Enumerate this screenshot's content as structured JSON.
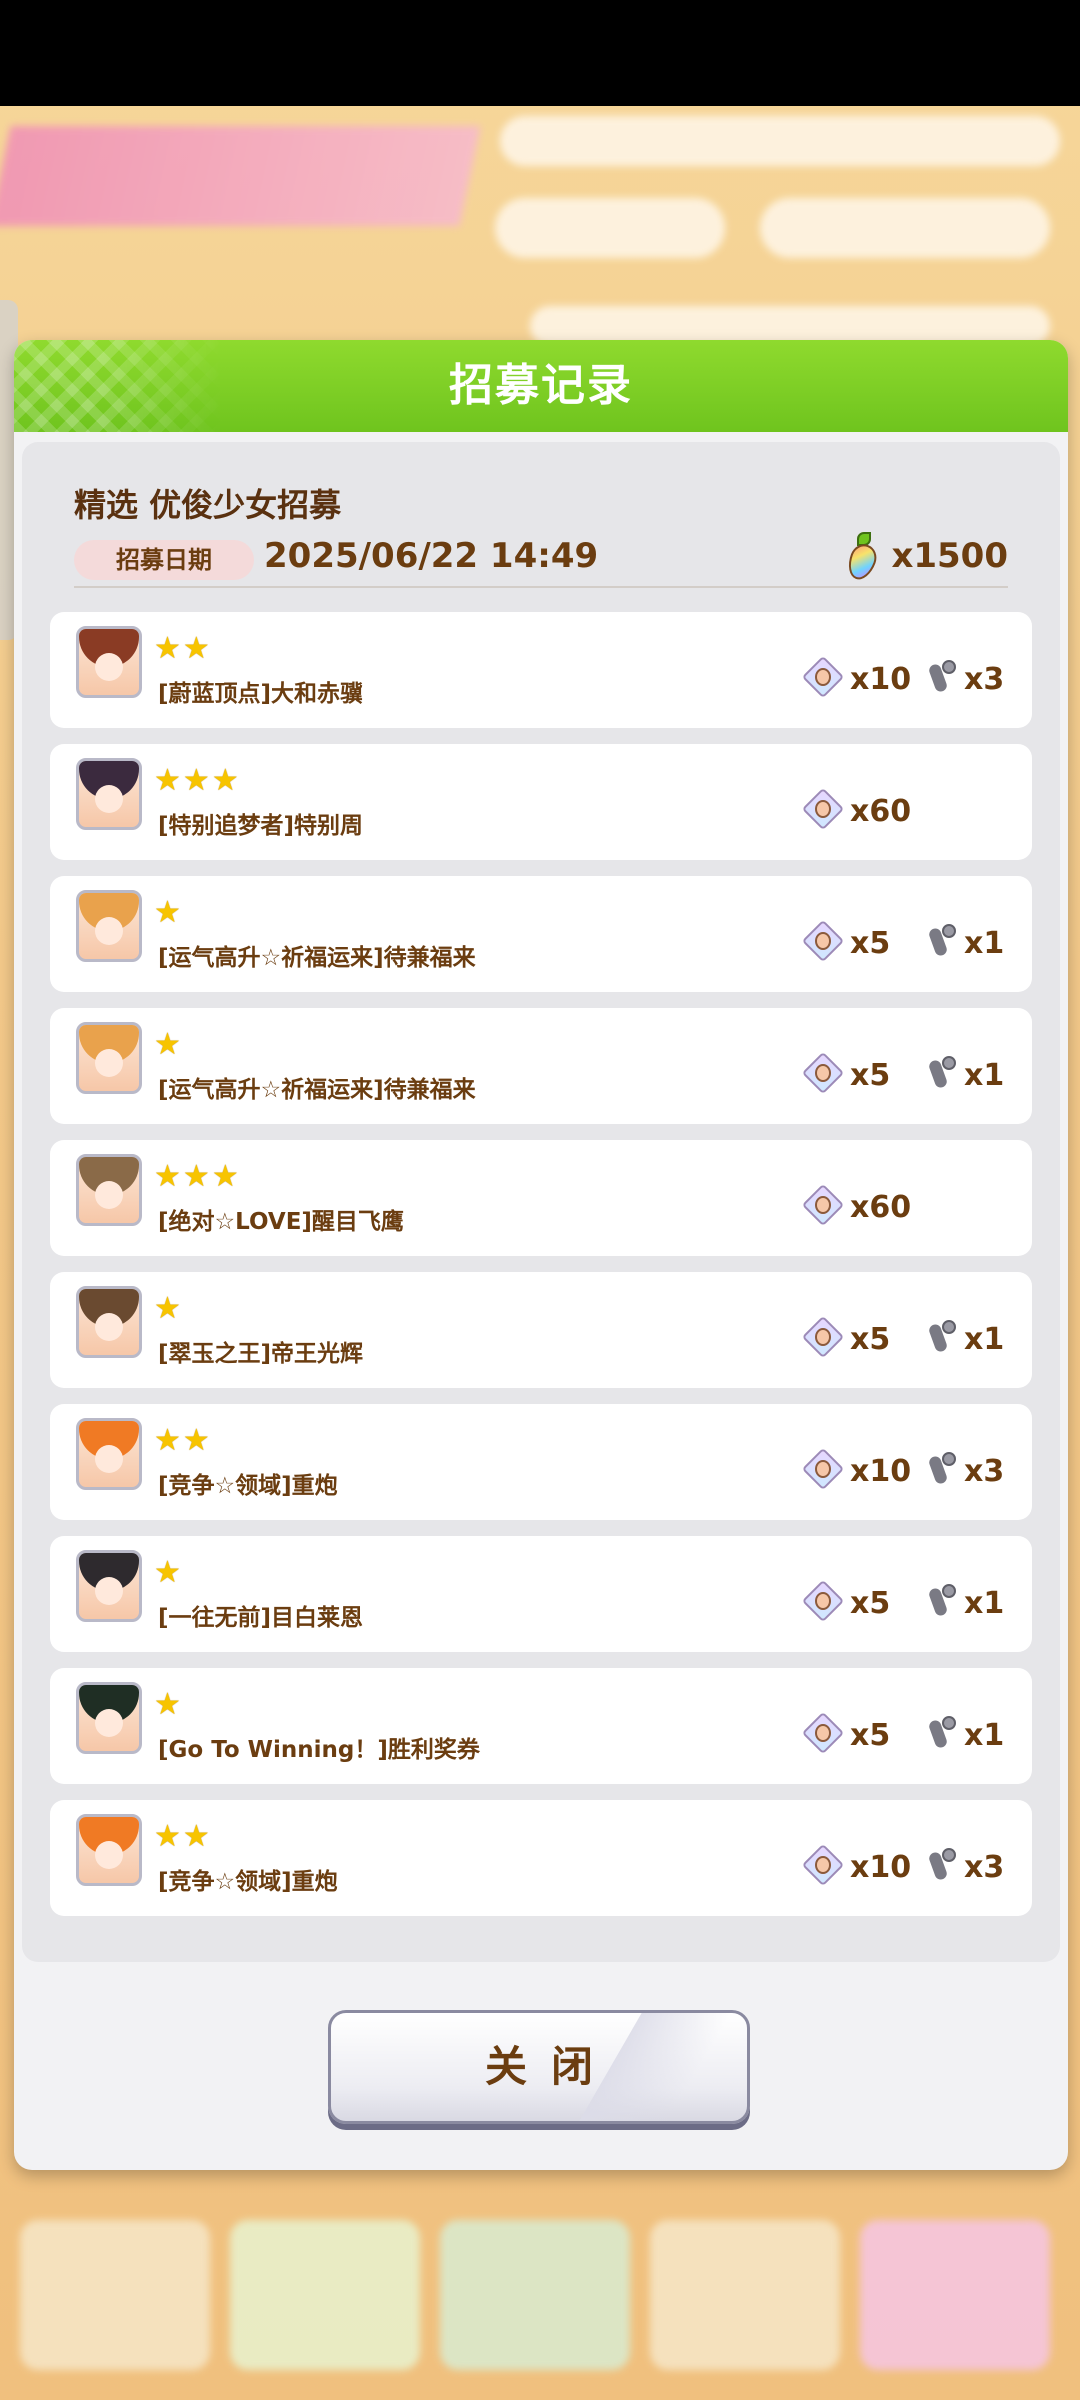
{
  "modal": {
    "title": "招募记录",
    "banner_name": "精选 优俊少女招募",
    "date_label": "招募日期",
    "date_value": "2025/06/22 14:49",
    "cost_value": "x1500",
    "close_label": "关闭"
  },
  "rows": [
    {
      "stars": 2,
      "name": "[蔚蓝顶点]大和赤骥",
      "pieces": "x10",
      "shoes": "x3",
      "hair": "#8a3b24"
    },
    {
      "stars": 3,
      "name": "[特别追梦者]特别周",
      "pieces": "x60",
      "shoes": "",
      "hair": "#3b2a3e"
    },
    {
      "stars": 1,
      "name": "[运气高升☆祈福运来]待兼福来",
      "pieces": "x5",
      "shoes": "x1",
      "hair": "#e9a24c"
    },
    {
      "stars": 1,
      "name": "[运气高升☆祈福运来]待兼福来",
      "pieces": "x5",
      "shoes": "x1",
      "hair": "#e9a24c"
    },
    {
      "stars": 3,
      "name": "[绝对☆LOVE]醒目飞鹰",
      "pieces": "x60",
      "shoes": "",
      "hair": "#8a6a48"
    },
    {
      "stars": 1,
      "name": "[翠玉之王]帝王光辉",
      "pieces": "x5",
      "shoes": "x1",
      "hair": "#6a4a30"
    },
    {
      "stars": 2,
      "name": "[竞争☆领域]重炮",
      "pieces": "x10",
      "shoes": "x3",
      "hair": "#f07a24"
    },
    {
      "stars": 1,
      "name": "[一往无前]目白莱恩",
      "pieces": "x5",
      "shoes": "x1",
      "hair": "#2e2a2e"
    },
    {
      "stars": 1,
      "name": "[Go To Winning！]胜利奖券",
      "pieces": "x5",
      "shoes": "x1",
      "hair": "#1f2e24"
    },
    {
      "stars": 2,
      "name": "[竞争☆领域]重炮",
      "pieces": "x10",
      "shoes": "x3",
      "hair": "#f07a24"
    }
  ]
}
